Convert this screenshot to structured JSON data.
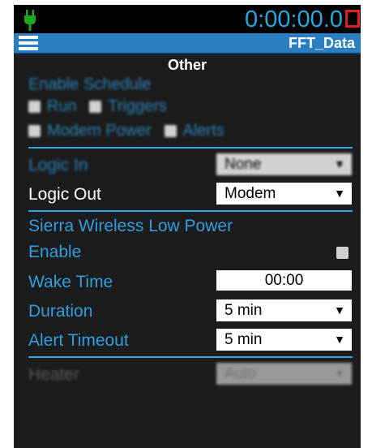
{
  "header": {
    "timer": "0:00:00.0",
    "icons": {
      "power": "plug-icon",
      "stop": "stop-icon",
      "menu": "hamburger-menu-icon"
    },
    "colors": {
      "accent": "#29a8e0",
      "plug": "#1ea81e",
      "stop": "#e02020",
      "navbar": "#2a7fc2"
    }
  },
  "navbar": {
    "title": "FFT_Data"
  },
  "section": {
    "title": "Other"
  },
  "schedule": {
    "title": "Enable Schedule",
    "options": [
      "Run",
      "Triggers",
      "Modem Power",
      "Alerts"
    ]
  },
  "logic_in": {
    "label": "Logic In",
    "value": "None"
  },
  "logic_out": {
    "label": "Logic Out",
    "value": "Modem"
  },
  "sierra": {
    "title": "Sierra Wireless Low Power",
    "enable_label": "Enable",
    "wake_time_label": "Wake Time",
    "wake_time_value": "00:00",
    "duration_label": "Duration",
    "duration_value": "5 min",
    "alert_timeout_label": "Alert Timeout",
    "alert_timeout_value": "5 min"
  },
  "heater": {
    "label": "Heater",
    "value": "Auto"
  }
}
